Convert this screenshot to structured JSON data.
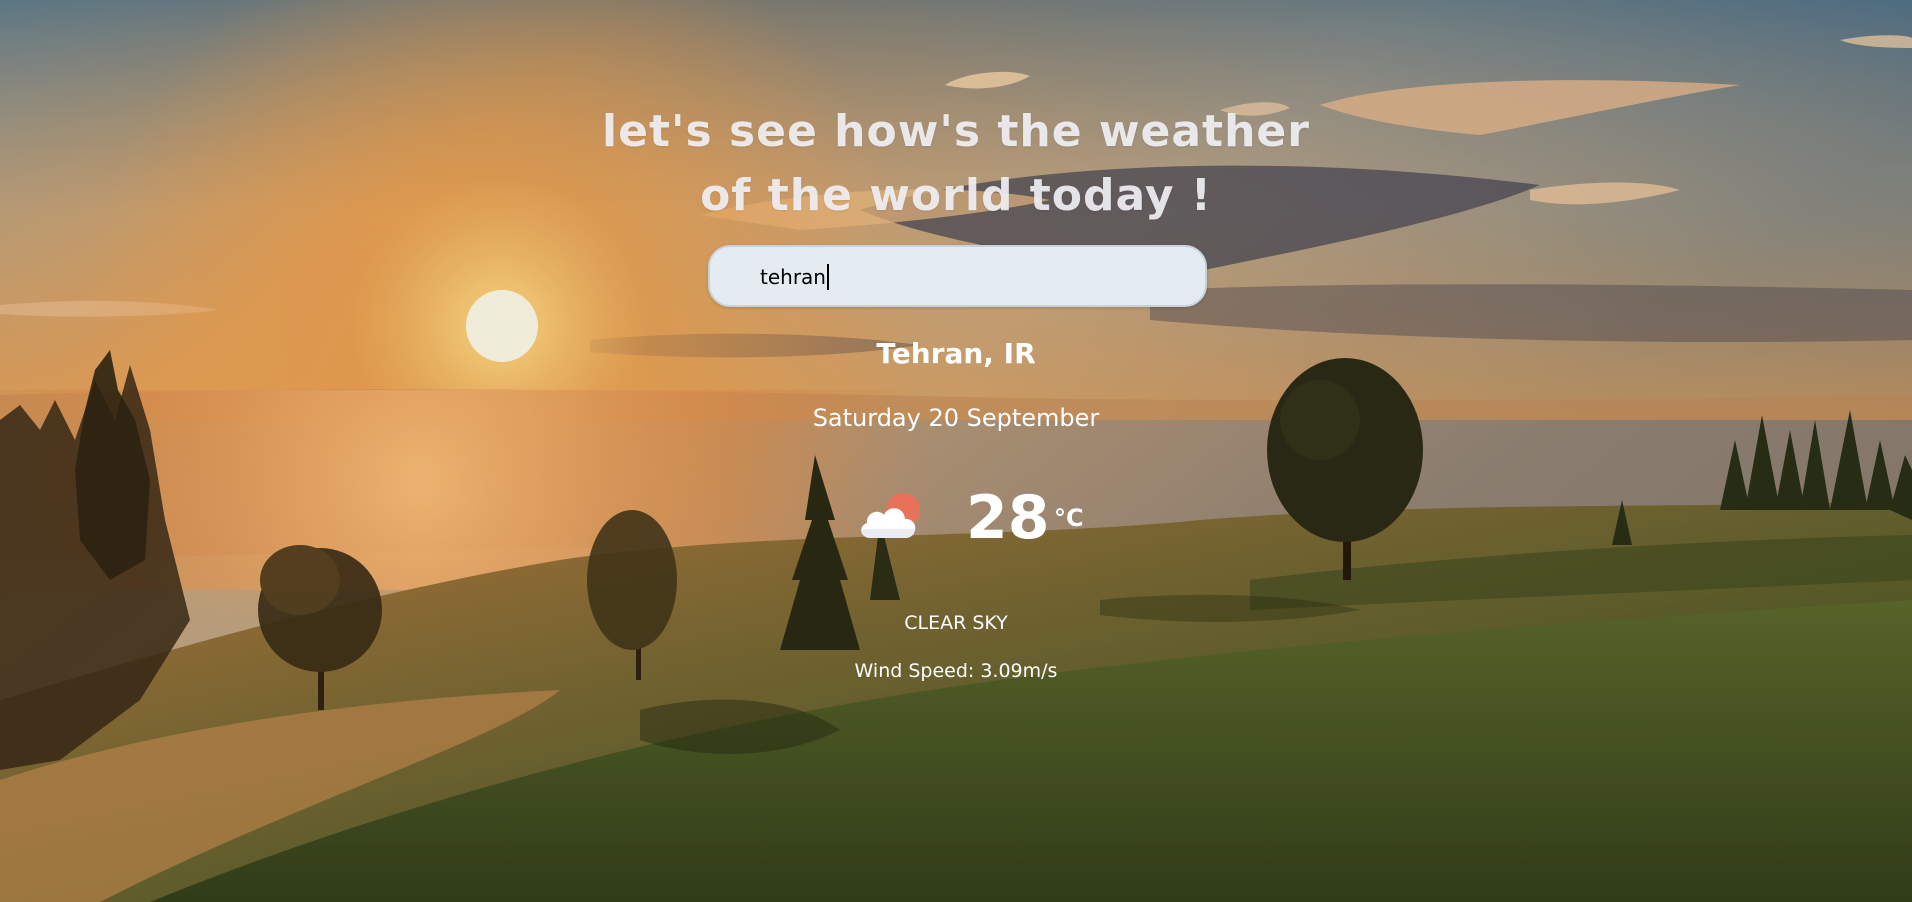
{
  "header": {
    "headline_line1": "let's see how's the weather",
    "headline_line2": "of the world today !"
  },
  "search": {
    "value": "tehran",
    "placeholder": ""
  },
  "weather": {
    "city": "Tehran, IR",
    "date": "Saturday 20 September",
    "temperature": "28",
    "unit": "°C",
    "description": "CLEAR SKY",
    "wind": "Wind Speed: 3.09m/s",
    "icon": "cloud-sun-icon"
  },
  "colors": {
    "search_bg": "#e4ecf1",
    "text": "#ffffff",
    "sun_accent": "#e8715a"
  }
}
